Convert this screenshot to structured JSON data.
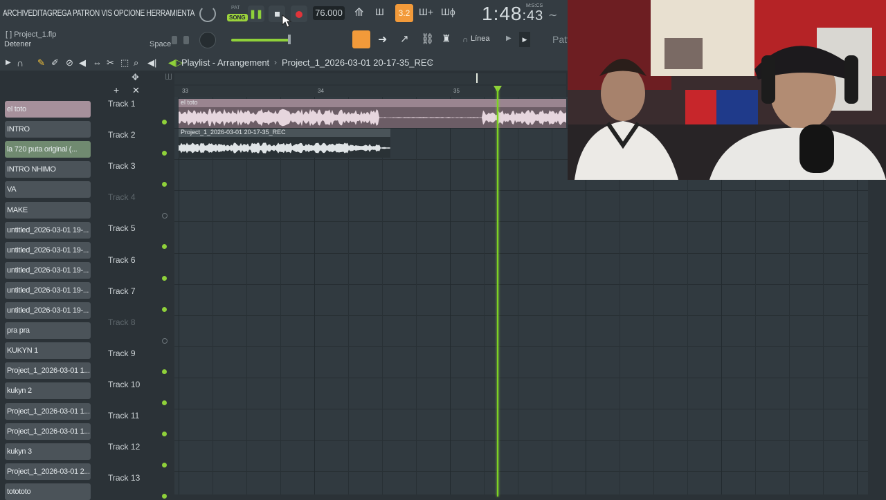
{
  "menu": [
    "ARCHIV",
    "EDITA",
    "GREGA",
    "PATRON",
    "VIS",
    "OPCIONE",
    "HERRAMIENTA"
  ],
  "transport": {
    "pat_label": "PAT",
    "song_label": "SONG",
    "tempo": "76.000",
    "snap_value": "3.2",
    "time_main": "1:48",
    "time_small": ":43",
    "time_unit": "M:S:CS"
  },
  "hint": {
    "project_file": "[ ]  Project_1.flp",
    "message": "Detener",
    "key": "Space"
  },
  "snap_mode": "Línea",
  "pattern_selector": "Patt",
  "playlist": {
    "title": "Playlist - Arrangement",
    "breadcrumb": "Project_1_2026-03-01 20-17-35_REC",
    "ruler": [
      "33",
      "34",
      "35"
    ]
  },
  "patterns": [
    {
      "label": "el toto",
      "style": "active"
    },
    {
      "label": "INTRO",
      "style": ""
    },
    {
      "label": "la 720 puta original (...",
      "style": "green"
    },
    {
      "label": "INTRO NHIMO",
      "style": ""
    },
    {
      "label": "VA",
      "style": ""
    },
    {
      "label": "MAKE",
      "style": ""
    },
    {
      "label": "untitled_2026-03-01 19-...",
      "style": ""
    },
    {
      "label": "untitled_2026-03-01 19-...",
      "style": ""
    },
    {
      "label": "untitled_2026-03-01 19-...",
      "style": ""
    },
    {
      "label": "untitled_2026-03-01 19-...",
      "style": ""
    },
    {
      "label": "untitled_2026-03-01 19-...",
      "style": ""
    },
    {
      "label": "pra pra",
      "style": ""
    },
    {
      "label": "KUKYN 1",
      "style": ""
    },
    {
      "label": "Project_1_2026-03-01 1...",
      "style": ""
    },
    {
      "label": "kukyn 2",
      "style": ""
    },
    {
      "label": "Project_1_2026-03-01 1...",
      "style": ""
    },
    {
      "label": "Project_1_2026-03-01 1...",
      "style": ""
    },
    {
      "label": "kukyn 3",
      "style": ""
    },
    {
      "label": "Project_1_2026-03-01 2...",
      "style": ""
    },
    {
      "label": "totototo",
      "style": ""
    }
  ],
  "tracks": [
    {
      "label": "Track 1",
      "enabled": true
    },
    {
      "label": "Track 2",
      "enabled": true
    },
    {
      "label": "Track 3",
      "enabled": true
    },
    {
      "label": "Track 4",
      "enabled": false
    },
    {
      "label": "Track 5",
      "enabled": true
    },
    {
      "label": "Track 6",
      "enabled": true
    },
    {
      "label": "Track 7",
      "enabled": true
    },
    {
      "label": "Track 8",
      "enabled": false
    },
    {
      "label": "Track 9",
      "enabled": true
    },
    {
      "label": "Track 10",
      "enabled": true
    },
    {
      "label": "Track 11",
      "enabled": true
    },
    {
      "label": "Track 12",
      "enabled": true
    },
    {
      "label": "Track 13",
      "enabled": true
    }
  ],
  "clips": [
    {
      "label": "el toto",
      "track": 1
    },
    {
      "label": "Project_1_2026-03-01 20-17-35_REC",
      "track": 2
    }
  ],
  "colors": {
    "accent_green": "#8fd13a",
    "record_red": "#e0343a",
    "snap_orange": "#f29a3a",
    "clip_pink": "#9a8590"
  }
}
